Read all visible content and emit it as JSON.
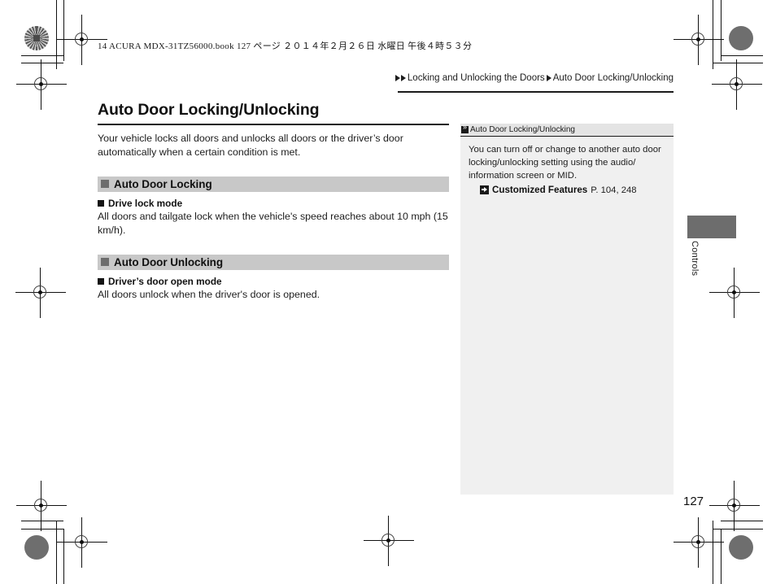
{
  "print_header": {
    "book_line": "14 ACURA MDX-31TZ56000.book   127 ページ   ２０１４年２月２６日   水曜日   午後４時５３分"
  },
  "breadcrumb": {
    "marker_icon": "triangle-right-icon",
    "level1": "Locking and Unlocking the Doors",
    "separator_icon": "triangle-right-icon",
    "level2": "Auto Door Locking/Unlocking"
  },
  "main": {
    "title": "Auto Door Locking/Unlocking",
    "intro": "Your vehicle locks all doors and unlocks all doors or the driver’s door automatically when a certain condition is met.",
    "sections": [
      {
        "heading": "Auto Door Locking",
        "subheading": "Drive lock mode",
        "body": "All doors and tailgate lock when the vehicle's speed reaches about 10 mph (15 km/h)."
      },
      {
        "heading": "Auto Door Unlocking",
        "subheading": "Driver’s door open mode",
        "body": "All doors unlock when the driver's door is opened."
      }
    ]
  },
  "sidenote": {
    "header_icon": "note-marker-icon",
    "header": "Auto Door Locking/Unlocking",
    "body": "You can turn off or change to another auto door locking/unlocking setting using the audio/ information screen or MID.",
    "reference": {
      "icon": "go-to-reference-icon",
      "name": "Customized Features",
      "page": "P. 104, 248"
    }
  },
  "side_tab": {
    "label": "Controls",
    "color": "#6d6d6d"
  },
  "footer": {
    "page_number": "127"
  },
  "colors": {
    "section_bar": "#c8c8c8",
    "section_bullet": "#6d6d6d",
    "sidebox_header": "#e4e4e4",
    "sidebox_body": "#f0f0f0",
    "rule": "#1a1a1a"
  }
}
